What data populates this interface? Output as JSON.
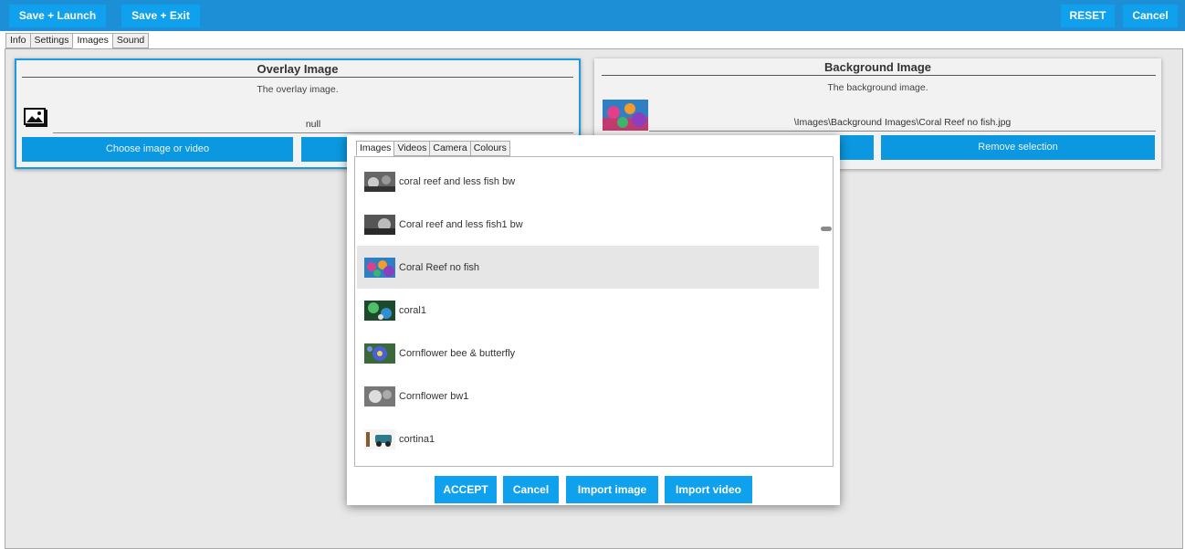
{
  "toolbar": {
    "save_launch": "Save + Launch",
    "save_exit": "Save + Exit",
    "reset": "RESET",
    "cancel": "Cancel"
  },
  "tabs": [
    "Info",
    "Settings",
    "Images",
    "Sound"
  ],
  "overlay": {
    "title": "Overlay Image",
    "description": "The overlay image.",
    "path": "null",
    "choose_button": "Choose image or video"
  },
  "background": {
    "title": "Background Image",
    "description": "The background image.",
    "path": "\\Images\\Background Images\\Coral Reef no fish.jpg",
    "remove_button": "Remove selection"
  },
  "picker": {
    "tabs": [
      "Images",
      "Videos",
      "Camera",
      "Colours"
    ],
    "items": [
      {
        "label": "coral reef and less fish bw",
        "selected": false
      },
      {
        "label": "Coral reef and less fish1 bw",
        "selected": false
      },
      {
        "label": "Coral Reef no fish",
        "selected": true
      },
      {
        "label": "coral1",
        "selected": false
      },
      {
        "label": "Cornflower bee & butterfly",
        "selected": false
      },
      {
        "label": "Cornflower bw1",
        "selected": false
      },
      {
        "label": "cortina1",
        "selected": false
      }
    ],
    "buttons": {
      "accept": "ACCEPT",
      "cancel": "Cancel",
      "import_image": "Import image",
      "import_video": "Import video"
    }
  },
  "colors": {
    "topbar": "#1d8fd6",
    "button": "#0fa0ee",
    "panel_border": "#1a9be0",
    "selected_row": "#e6e6e6"
  }
}
